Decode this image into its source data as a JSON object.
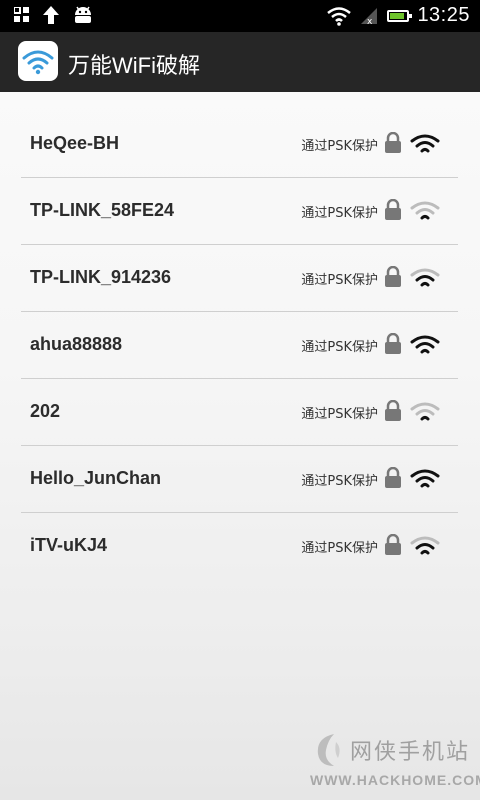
{
  "status_bar": {
    "time": "13:25",
    "battery_level": 0.9,
    "icons": [
      "apps-grid-icon",
      "upload-arrow-icon",
      "android-icon",
      "wifi-icon",
      "cell-signal-icon",
      "battery-icon"
    ]
  },
  "app_bar": {
    "title": "万能WiFi破解",
    "icon": "wifi-app-icon"
  },
  "networks": [
    {
      "ssid": "HeQee-BH",
      "security": "通过PSK保护",
      "signal": "strong"
    },
    {
      "ssid": "TP-LINK_58FE24",
      "security": "通过PSK保护",
      "signal": "weak"
    },
    {
      "ssid": "TP-LINK_914236",
      "security": "通过PSK保护",
      "signal": "medium"
    },
    {
      "ssid": "ahua88888",
      "security": "通过PSK保护",
      "signal": "strong"
    },
    {
      "ssid": "202",
      "security": "通过PSK保护",
      "signal": "weak"
    },
    {
      "ssid": "Hello_JunChan",
      "security": "通过PSK保护",
      "signal": "strong"
    },
    {
      "ssid": "iTV-uKJ4",
      "security": "通过PSK保护",
      "signal": "medium"
    }
  ],
  "watermark": {
    "name": "网侠手机站",
    "url": "WWW.HACKHOME.COM"
  },
  "colors": {
    "status_bar": "#000000",
    "action_bar": "#262626",
    "wifi_blue": "#3a9ad9",
    "battery_green": "#6ec42b"
  }
}
